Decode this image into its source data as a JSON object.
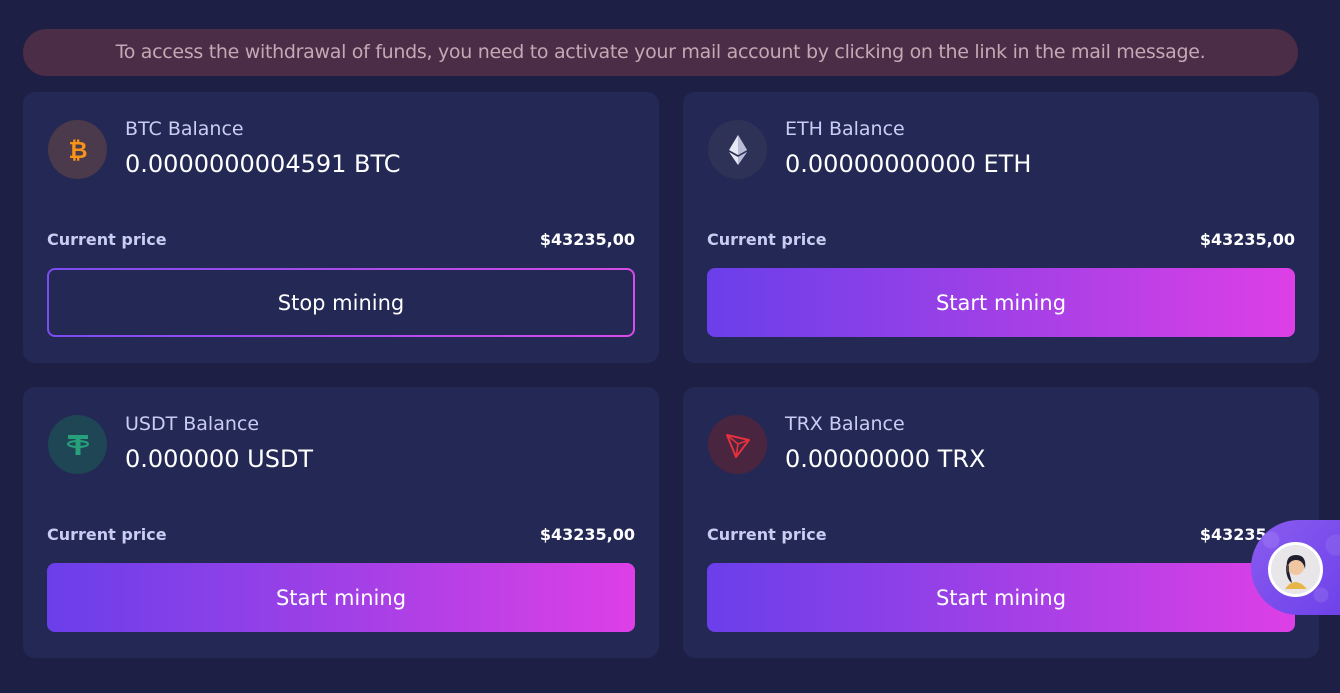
{
  "notice": {
    "text": "To access the withdrawal of funds, you need to activate your mail account by clicking on the link in the mail message."
  },
  "cards": [
    {
      "coin_icon": "bitcoin-icon",
      "balance_label": "BTC Balance",
      "balance_value": "0.0000000004591 BTC",
      "price_label": "Current price",
      "price_value": "$43235,00",
      "button_label": "Stop mining",
      "accent": "#f7931a"
    },
    {
      "coin_icon": "ethereum-icon",
      "balance_label": "ETH Balance",
      "balance_value": "0.00000000000 ETH",
      "price_label": "Current price",
      "price_value": "$43235,00",
      "button_label": "Start mining",
      "accent": "#e6e8f5"
    },
    {
      "coin_icon": "tether-icon",
      "balance_label": "USDT Balance",
      "balance_value": "0.000000 USDT",
      "price_label": "Current price",
      "price_value": "$43235,00",
      "button_label": "Start mining",
      "accent": "#26a17b"
    },
    {
      "coin_icon": "tron-icon",
      "balance_label": "TRX Balance",
      "balance_value": "0.00000000 TRX",
      "price_label": "Current price",
      "price_value": "$43235,00",
      "button_label": "Start mining",
      "accent": "#e5303d"
    }
  ],
  "chat_widget": {
    "icon": "support-avatar-icon"
  },
  "colors": {
    "background": "#1d2044",
    "card": "#242855",
    "notice_bg": "#4b2d47",
    "button_gradient_start": "#6a3fea",
    "button_gradient_end": "#de3fe6"
  }
}
